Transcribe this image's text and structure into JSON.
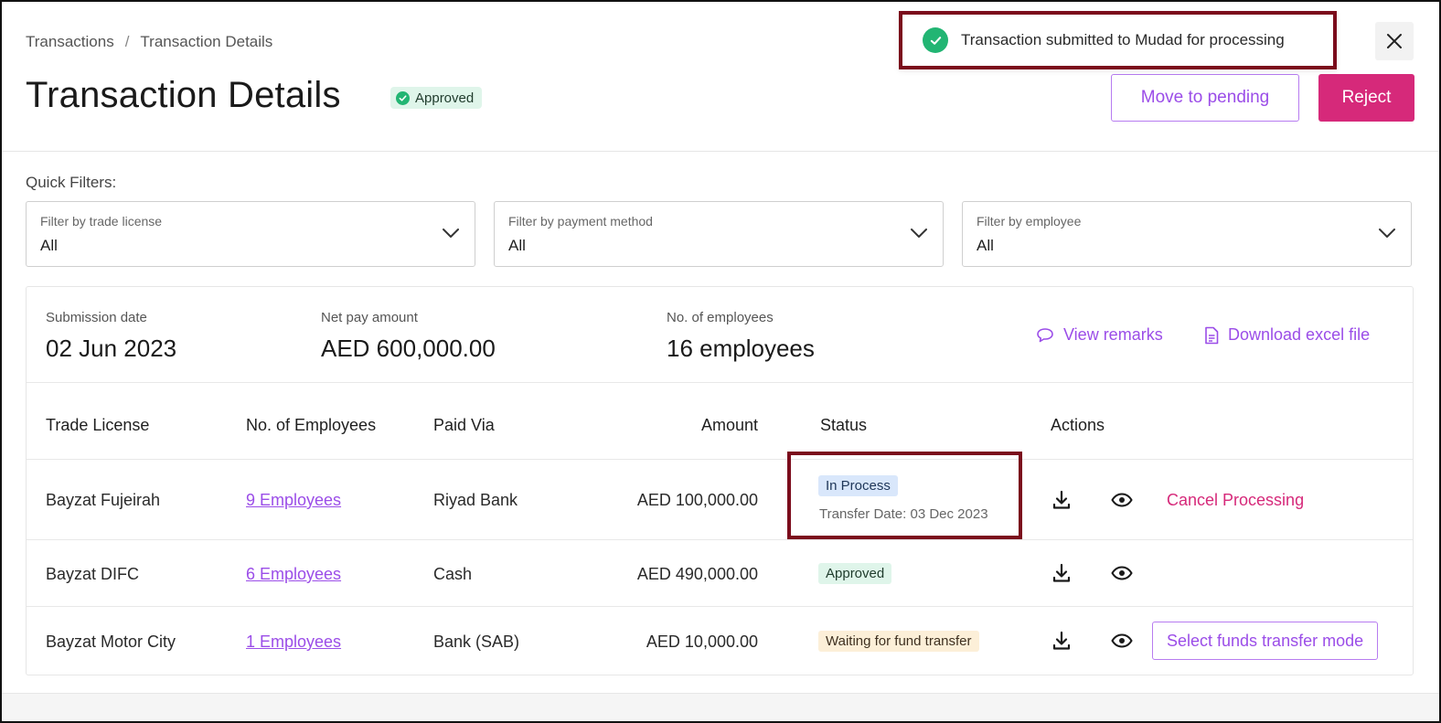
{
  "breadcrumb": {
    "root": "Transactions",
    "separator": "/",
    "current": "Transaction Details"
  },
  "header": {
    "title": "Transaction Details",
    "status_badge": "Approved",
    "move_to_pending_label": "Move to pending",
    "reject_label": "Reject"
  },
  "toast": {
    "message": "Transaction submitted to Mudad for processing"
  },
  "filters": {
    "label": "Quick Filters:",
    "items": [
      {
        "label": "Filter by trade license",
        "value": "All"
      },
      {
        "label": "Filter by payment method",
        "value": "All"
      },
      {
        "label": "Filter by employee",
        "value": "All"
      }
    ]
  },
  "summary": {
    "submission_date_label": "Submission date",
    "submission_date": "02 Jun 2023",
    "net_pay_label": "Net pay amount",
    "net_pay": "AED 600,000.00",
    "employees_label": "No. of employees",
    "employees": "16 employees",
    "view_remarks": "View remarks",
    "download_excel": "Download excel file"
  },
  "table": {
    "columns": [
      "Trade License",
      "No. of Employees",
      "Paid Via",
      "Amount",
      "Status",
      "Actions"
    ],
    "rows": [
      {
        "trade_license": "Bayzat Fujeirah",
        "employees": "9 Employees",
        "paid_via": "Riyad Bank",
        "amount": "AED 100,000.00",
        "status": "In Process",
        "transfer_date": "Transfer Date: 03 Dec 2023",
        "action": "Cancel Processing"
      },
      {
        "trade_license": "Bayzat DIFC",
        "employees": "6 Employees",
        "paid_via": "Cash",
        "amount": "AED 490,000.00",
        "status": "Approved"
      },
      {
        "trade_license": "Bayzat Motor City",
        "employees": "1 Employees",
        "paid_via": "Bank (SAB)",
        "amount": "AED 10,000.00",
        "status": "Waiting for fund transfer",
        "action": "Select funds transfer mode"
      }
    ]
  },
  "colors": {
    "accent_purple": "#9b4de8",
    "reject_pink": "#d6297a",
    "success_green": "#22b573",
    "highlight_maroon": "#7b0c1c"
  },
  "icons": [
    "check-circle-icon",
    "close-icon",
    "chevron-down-icon",
    "comment-icon",
    "file-icon",
    "download-icon",
    "eye-icon"
  ]
}
